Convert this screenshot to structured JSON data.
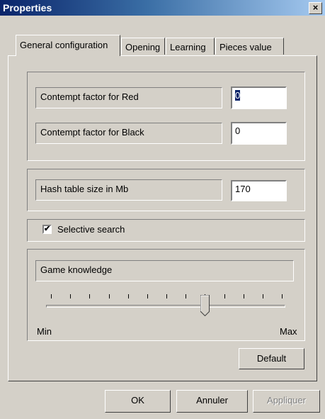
{
  "window": {
    "title": "Properties",
    "close_glyph": "×"
  },
  "tabs": [
    {
      "label": "General configuration",
      "active": true
    },
    {
      "label": "Opening",
      "active": false
    },
    {
      "label": "Learning",
      "active": false
    },
    {
      "label": "Pieces value",
      "active": false
    }
  ],
  "contempt": {
    "red_label": "Contempt factor for Red",
    "red_value": "0",
    "black_label": "Contempt factor for Black",
    "black_value": "0"
  },
  "hash": {
    "label": "Hash table size in Mb",
    "value": "170"
  },
  "selective": {
    "label": "Selective search",
    "checked": true
  },
  "knowledge": {
    "label": "Game knowledge",
    "min_label": "Min",
    "max_label": "Max",
    "ticks": 13,
    "level_fraction": 0.667
  },
  "buttons": {
    "default": "Default",
    "ok": "OK",
    "cancel": "Annuler",
    "apply": "Appliquer"
  },
  "colors": {
    "title_start": "#0a246a",
    "title_end": "#a6caf0",
    "face": "#d4d0c8"
  }
}
